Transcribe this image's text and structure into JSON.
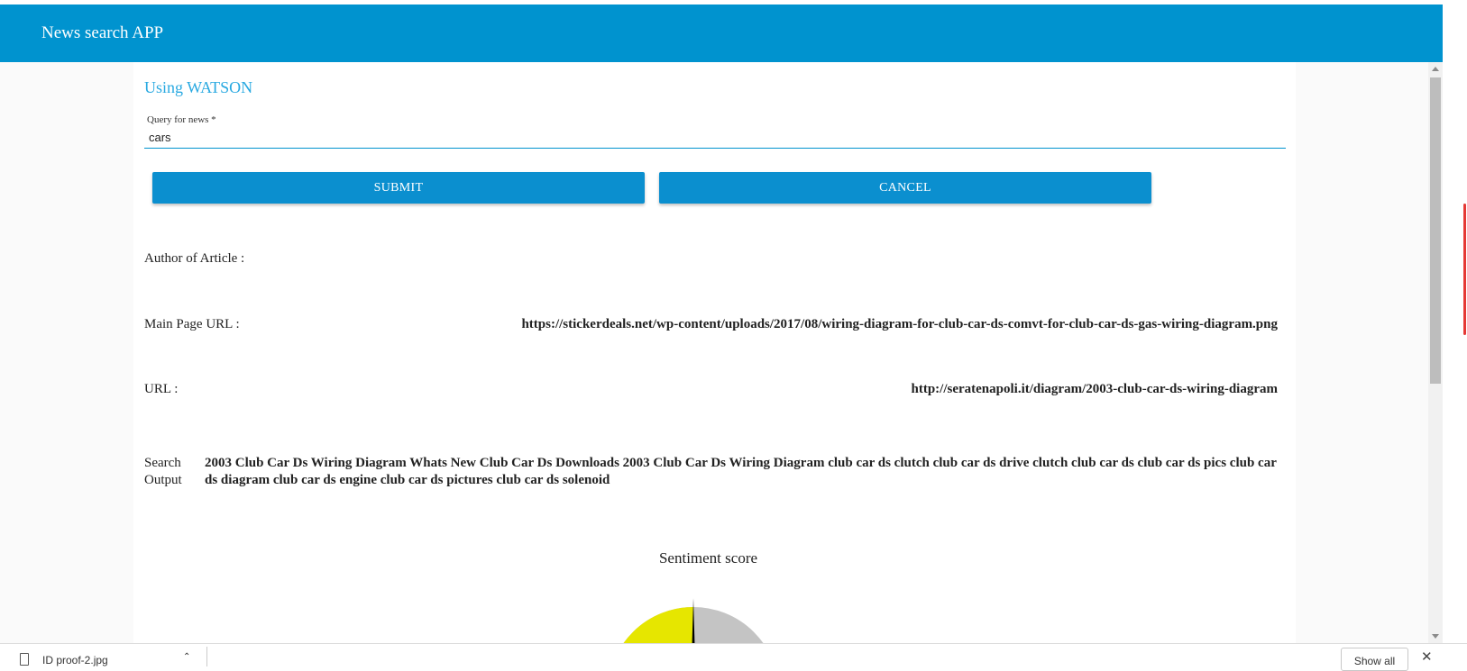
{
  "appbar": {
    "title": "News search APP"
  },
  "main": {
    "subtitle": "Using WATSON",
    "query": {
      "label": "Query for news *",
      "value": "cars"
    },
    "buttons": {
      "submit": "SUBMIT",
      "cancel": "CANCEL"
    },
    "author": {
      "label": "Author of Article :",
      "value": ""
    },
    "main_page_url": {
      "label": "Main Page URL :",
      "value": "https://stickerdeals.net/wp-content/uploads/2017/08/wiring-diagram-for-club-car-ds-comvt-for-club-car-ds-gas-wiring-diagram.png"
    },
    "url": {
      "label": "URL :",
      "value": "http://seratenapoli.it/diagram/2003-club-car-ds-wiring-diagram"
    },
    "search_output": {
      "label": "Search Output",
      "value": "2003 Club Car Ds Wiring Diagram Whats New Club Car Ds Downloads 2003 Club Car Ds Wiring Diagram club car ds clutch club car ds drive clutch club car ds club car ds pics club car ds diagram club car ds engine club car ds pictures club car ds solenoid"
    },
    "gauge": {
      "title": "Sentiment score",
      "fill_fraction": 0.5,
      "colors": {
        "fill": "#e6e600",
        "track": "#c4c4c4",
        "needle": "#000000"
      }
    }
  },
  "downloads": {
    "file_name": "ID proof-2.jpg",
    "show_all": "Show all",
    "file_icon": "file-icon",
    "close_icon": "close-icon"
  },
  "colors": {
    "primary": "#0093cf",
    "accent_text": "#29a9e1"
  }
}
